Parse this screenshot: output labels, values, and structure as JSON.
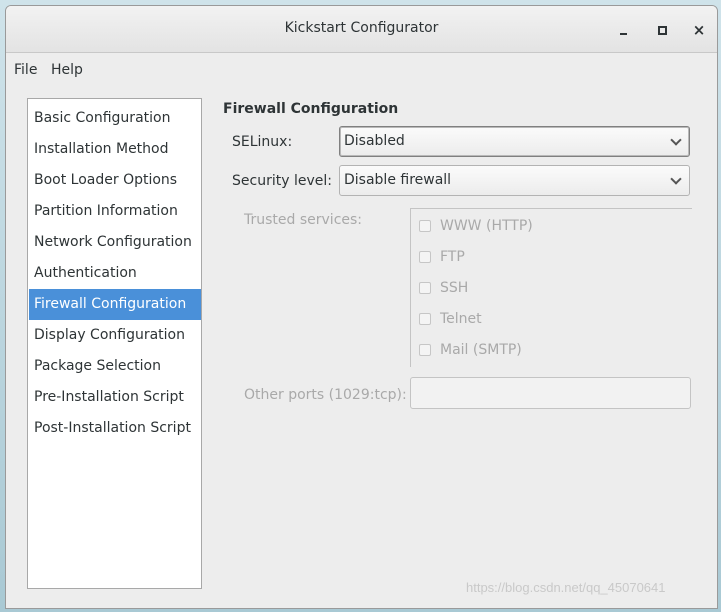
{
  "window": {
    "title": "Kickstart Configurator",
    "controls": {
      "minimize": "minimize-icon",
      "maximize": "maximize-icon",
      "close": "×"
    }
  },
  "menubar": {
    "file": "File",
    "help": "Help"
  },
  "sidebar": {
    "items": [
      {
        "label": "Basic Configuration"
      },
      {
        "label": "Installation Method"
      },
      {
        "label": "Boot Loader Options"
      },
      {
        "label": "Partition Information"
      },
      {
        "label": "Network Configuration"
      },
      {
        "label": "Authentication"
      },
      {
        "label": "Firewall Configuration",
        "selected": true
      },
      {
        "label": "Display Configuration"
      },
      {
        "label": "Package Selection"
      },
      {
        "label": "Pre-Installation Script"
      },
      {
        "label": "Post-Installation Script"
      }
    ]
  },
  "main": {
    "section_title": "Firewall Configuration",
    "selinux": {
      "label": "SELinux:",
      "value": "Disabled"
    },
    "security_level": {
      "label": "Security level:",
      "value": "Disable firewall"
    },
    "trusted_services": {
      "label": "Trusted services:",
      "items": [
        {
          "label": "WWW (HTTP)",
          "checked": false
        },
        {
          "label": "FTP",
          "checked": false
        },
        {
          "label": "SSH",
          "checked": false
        },
        {
          "label": "Telnet",
          "checked": false
        },
        {
          "label": "Mail (SMTP)",
          "checked": false
        }
      ]
    },
    "other_ports": {
      "label": "Other ports (1029:tcp):",
      "value": ""
    }
  },
  "watermark": "https://blog.csdn.net/qq_45070641",
  "colors": {
    "selection": "#4a90d9",
    "background": "#ededed"
  }
}
